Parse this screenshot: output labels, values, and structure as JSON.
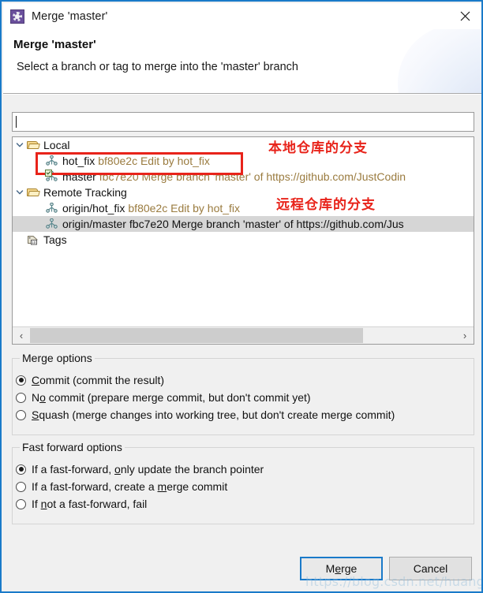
{
  "window": {
    "title": "Merge 'master'",
    "icon": "gear-icon",
    "close_label": "✕"
  },
  "header": {
    "title": "Merge 'master'",
    "subtitle": "Select a branch or tag to merge into the 'master' branch"
  },
  "filter": {
    "value": "",
    "placeholder": ""
  },
  "tree": {
    "nodes": [
      {
        "label": "Local",
        "icon": "folder-open-icon",
        "expanded": true,
        "level": 0,
        "selected": false,
        "meta": ""
      },
      {
        "label": "hot_fix",
        "meta": "bf80e2c Edit by hot_fix",
        "icon": "branch-icon",
        "level": 1,
        "selected": false,
        "expanded": null
      },
      {
        "label": "master",
        "meta": "fbc7e20 Merge branch 'master' of https://github.com/JustCodin",
        "icon": "branch-checked-icon",
        "level": 1,
        "selected": false,
        "expanded": null
      },
      {
        "label": "Remote Tracking",
        "icon": "folder-open-icon",
        "expanded": true,
        "level": 0,
        "selected": false,
        "meta": ""
      },
      {
        "label": "origin/hot_fix",
        "meta": "bf80e2c Edit by hot_fix",
        "icon": "branch-icon",
        "level": 1,
        "selected": false,
        "expanded": null
      },
      {
        "label": "origin/master",
        "meta": "fbc7e20 Merge branch 'master' of https://github.com/Jus",
        "icon": "branch-icon",
        "level": 1,
        "selected": true,
        "expanded": null
      },
      {
        "label": "Tags",
        "icon": "tags-icon",
        "expanded": null,
        "level": 0,
        "selected": false,
        "meta": ""
      }
    ],
    "scrollbar": {
      "left_arrow": "‹",
      "right_arrow": "›"
    }
  },
  "merge_options": {
    "title": "Merge options",
    "items": [
      {
        "pre": "",
        "mnem": "C",
        "post": "ommit (commit the result)",
        "selected": true
      },
      {
        "pre": "N",
        "mnem": "o",
        "post": " commit (prepare merge commit, but don't commit yet)",
        "selected": false
      },
      {
        "pre": "",
        "mnem": "S",
        "post": "quash (merge changes into working tree, but don't create merge commit)",
        "selected": false
      }
    ]
  },
  "fast_forward_options": {
    "title": "Fast forward options",
    "items": [
      {
        "pre": "If a fast-forward, ",
        "mnem": "o",
        "post": "nly update the branch pointer",
        "selected": true
      },
      {
        "pre": "If a fast-forward, create a ",
        "mnem": "m",
        "post": "erge commit",
        "selected": false
      },
      {
        "pre": "If ",
        "mnem": "n",
        "post": "ot a fast-forward, fail",
        "selected": false
      }
    ]
  },
  "footer": {
    "merge": {
      "pre": "M",
      "mnem": "e",
      "post": "rge",
      "label": "Merge",
      "default": true
    },
    "cancel": {
      "label": "Cancel"
    }
  },
  "annotations": {
    "local": "本地仓库的分支",
    "remote": "远程仓库的分支",
    "watermark": "https://blog.csdn.net/huangjinhai"
  },
  "colors": {
    "accent": "#1a7ac9",
    "annotation": "#e8231a",
    "meta_text": "#9a7b3f",
    "dialog_bg": "#f0f0f0",
    "selection": "#d6d6d6"
  }
}
